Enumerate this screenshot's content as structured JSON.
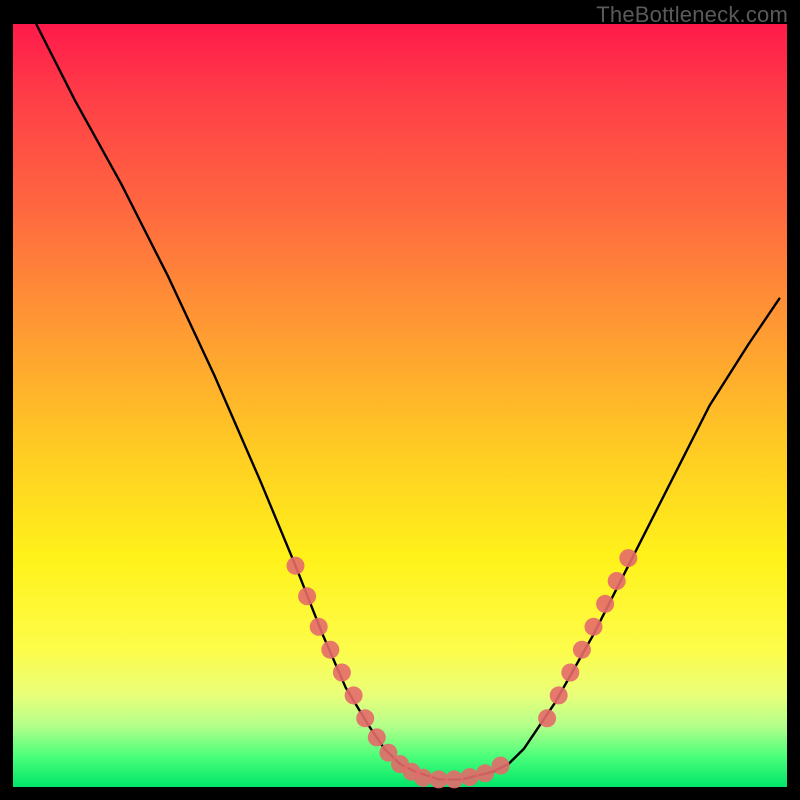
{
  "watermark": {
    "text": "TheBottleneck.com"
  },
  "chart_data": {
    "type": "line",
    "title": "",
    "xlabel": "",
    "ylabel": "",
    "xlim": [
      0,
      100
    ],
    "ylim": [
      0,
      100
    ],
    "grid": false,
    "legend": false,
    "series": [
      {
        "name": "curve",
        "color": "#000000",
        "x": [
          3,
          8,
          14,
          20,
          26,
          32,
          36.5,
          40,
          43,
          46,
          48,
          50,
          52,
          55,
          58,
          60,
          62,
          64,
          66,
          70,
          75,
          80,
          85,
          90,
          95,
          99
        ],
        "y": [
          100,
          90,
          79,
          67,
          54,
          40,
          29,
          20,
          13,
          8,
          5,
          3,
          2,
          1,
          1,
          1.5,
          2,
          3,
          5,
          11,
          20,
          30,
          40,
          50,
          58,
          64
        ]
      },
      {
        "name": "markers-left",
        "color": "#e46a6a",
        "type": "scatter",
        "x": [
          36.5,
          38,
          39.5,
          41,
          42.5,
          44,
          45.5,
          47,
          48.5,
          50,
          51.5
        ],
        "y": [
          29,
          25,
          21,
          18,
          15,
          12,
          9,
          6.5,
          4.5,
          3,
          2
        ]
      },
      {
        "name": "markers-bottom",
        "color": "#e46a6a",
        "type": "scatter",
        "x": [
          53,
          55,
          57,
          59,
          61,
          63
        ],
        "y": [
          1.2,
          1,
          1,
          1.3,
          1.8,
          2.8
        ]
      },
      {
        "name": "markers-right",
        "color": "#e46a6a",
        "type": "scatter",
        "x": [
          69,
          70.5,
          72,
          73.5,
          75,
          76.5,
          78,
          79.5
        ],
        "y": [
          9,
          12,
          15,
          18,
          21,
          24,
          27,
          30
        ]
      }
    ],
    "annotations": []
  }
}
